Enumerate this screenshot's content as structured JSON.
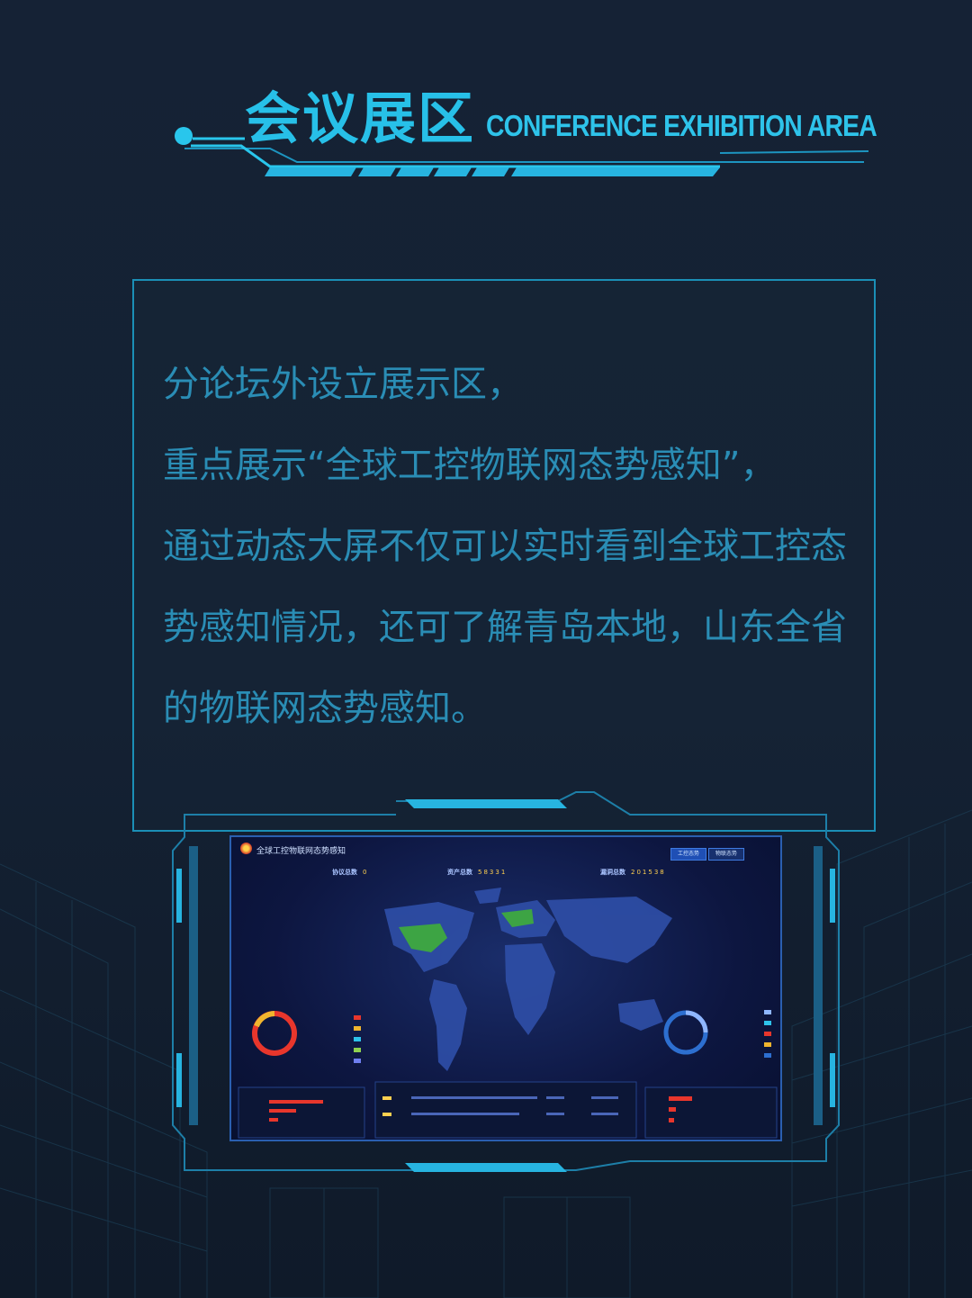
{
  "header": {
    "title_cn": "会议展区",
    "title_en": "CONFERENCE EXHIBITION AREA"
  },
  "panel": {
    "lines": [
      "分论坛外设立展示区，",
      "重点展示“全球工控物联网态势感知”，",
      "通过动态大屏不仅可以实时看到全球工控态",
      "势感知情况，还可了解青岛本地，山东全省",
      "的物联网态势感知。"
    ]
  },
  "screen": {
    "title": "全球工控物联网态势感知",
    "stats": [
      {
        "label": "协议总数",
        "value": "0"
      },
      {
        "label": "资产总数",
        "value": "58331"
      },
      {
        "label": "漏洞总数",
        "value": "201538"
      }
    ],
    "buttons": [
      "工控态势",
      "物联态势"
    ]
  },
  "colors": {
    "accent": "#27c0e8",
    "panel_text": "#2a8db5",
    "panel_border": "#1b8fb6",
    "background": "#152235"
  }
}
